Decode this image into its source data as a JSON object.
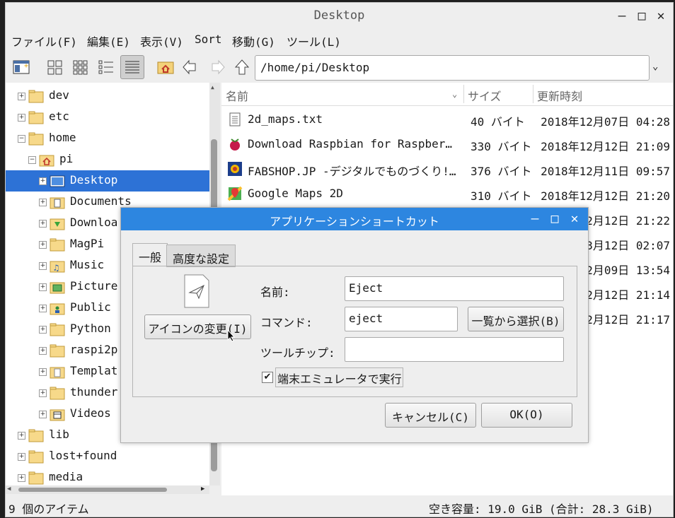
{
  "window": {
    "title": "Desktop"
  },
  "menu": [
    "ファイル(F)",
    "編集(E)",
    "表示(V)",
    "Sort",
    "移動(G)",
    "ツール(L)"
  ],
  "path": "/home/pi/Desktop",
  "tree": [
    {
      "label": "dev",
      "sign": "+",
      "icon": "folder-icon"
    },
    {
      "label": "etc",
      "sign": "+",
      "icon": "folder-icon"
    },
    {
      "label": "home",
      "sign": "−",
      "icon": "folder-icon"
    },
    {
      "label": "pi",
      "sign": "−",
      "icon": "home-folder-icon"
    },
    {
      "label": "Desktop",
      "sign": "+",
      "icon": "desktop-folder-icon"
    },
    {
      "label": "Documents",
      "sign": "+",
      "icon": "documents-folder-icon"
    },
    {
      "label": "Downloa",
      "sign": "+",
      "icon": "downloads-folder-icon"
    },
    {
      "label": "MagPi",
      "sign": "+",
      "icon": "folder-icon"
    },
    {
      "label": "Music",
      "sign": "+",
      "icon": "music-folder-icon"
    },
    {
      "label": "Picture",
      "sign": "+",
      "icon": "pictures-folder-icon"
    },
    {
      "label": "Public",
      "sign": "+",
      "icon": "public-folder-icon"
    },
    {
      "label": "Python",
      "sign": "+",
      "icon": "folder-icon"
    },
    {
      "label": "raspi2p",
      "sign": "+",
      "icon": "folder-icon"
    },
    {
      "label": "Templat",
      "sign": "+",
      "icon": "templates-folder-icon"
    },
    {
      "label": "thunder",
      "sign": "+",
      "icon": "folder-icon"
    },
    {
      "label": "Videos",
      "sign": "+",
      "icon": "videos-folder-icon"
    },
    {
      "label": "lib",
      "sign": "+",
      "icon": "folder-icon"
    },
    {
      "label": "lost+found",
      "sign": "+",
      "icon": "folder-icon"
    },
    {
      "label": "media",
      "sign": "+",
      "icon": "folder-icon"
    }
  ],
  "list": {
    "columns": {
      "name": "名前",
      "size": "サイズ",
      "modified": "更新時刻"
    },
    "rows": [
      {
        "name": "2d_maps.txt",
        "size": "40 バイト",
        "date": "2018年12月07日 04:28",
        "icon": "text-file-icon"
      },
      {
        "name": "Download Raspbian for Raspber…",
        "size": "330 バイト",
        "date": "2018年12月12日 21:09",
        "icon": "raspberry-icon"
      },
      {
        "name": "FABSHOP.JP -デジタルでものづくり!…",
        "size": "376 バイト",
        "date": "2018年12月11日 09:57",
        "icon": "fabshop-icon"
      },
      {
        "name": "Google Maps 2D",
        "size": "310 バイト",
        "date": "2018年12月12日 21:20",
        "icon": "maps-icon"
      },
      {
        "name": "",
        "size": "",
        "date": "2月12日 21:22",
        "icon": ""
      },
      {
        "name": "",
        "size": "",
        "date": "3月12日 02:07",
        "icon": ""
      },
      {
        "name": "",
        "size": "",
        "date": "2月09日 13:54",
        "icon": ""
      },
      {
        "name": "",
        "size": "",
        "date": "2月12日 21:14",
        "icon": ""
      },
      {
        "name": "",
        "size": "",
        "date": "2月12日 21:17",
        "icon": ""
      }
    ]
  },
  "status": {
    "items": "9 個のアイテム",
    "free": "空き容量: 19.0 GiB (合計: 28.3 GiB)"
  },
  "dialog": {
    "title": "アプリケーションショートカット",
    "tabs": [
      "一般",
      "高度な設定"
    ],
    "change_icon": "アイコンの変更(I)",
    "name_label": "名前:",
    "name_value": "Eject",
    "command_label": "コマンド:",
    "command_value": "eject",
    "browse": "一覧から選択(B)",
    "tooltip_label": "ツールチップ:",
    "tooltip_value": "",
    "terminal_label": "端末エミュレータで実行",
    "terminal_checked": "✔",
    "cancel": "キャンセル(C)",
    "ok": "OK(O)"
  }
}
